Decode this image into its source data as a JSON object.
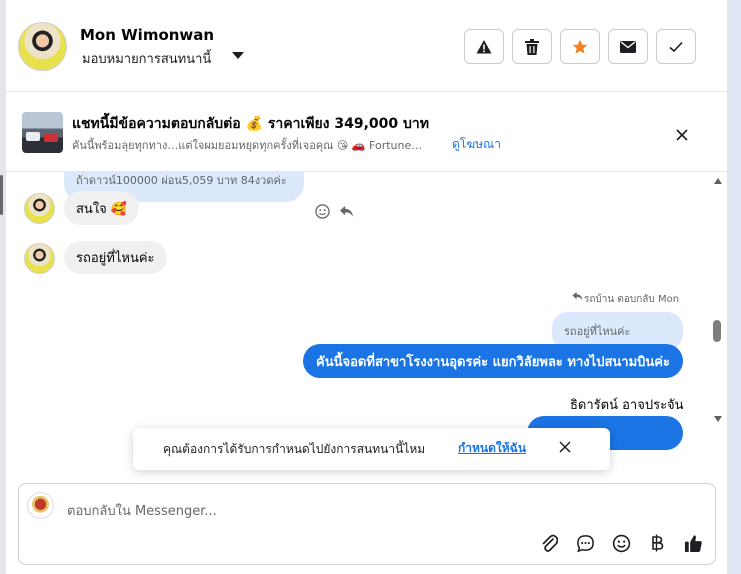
{
  "header": {
    "contact_name": "Mon Wimonwan",
    "assign_label": "มอบหมายการสนทนานี้",
    "actions": [
      "report-spam",
      "delete",
      "star",
      "mark-unread",
      "mark-done"
    ]
  },
  "ad": {
    "title": "แชทนี้มีข้อความตอบกลับต่อ 💰 ราคาเพียง 349,000 บาท",
    "subtitle": "คันนี้พร้อมลุยทุกทาง…แต่ใจผมยอมหยุดทุกครั้งที่เจอคุณ 😘 🚗 Fortune…",
    "link": "ดูโฆษณา"
  },
  "messages": {
    "cut_bubble": "ถ้าดาวน์100000 ผ่อน5,059 บาท 84งวดค่ะ",
    "incoming_1": "สนใจ 🥰",
    "incoming_2": "รถอยู่ที่ไหนค่ะ",
    "reply_note": "รถบ้าน ตอบกลับ Mon",
    "quoted_text": "รถอยู่ที่ไหนค่ะ",
    "outgoing_1": "คันนี้จอดที่สาขาโรงงานอุดรค่ะ แยกวิลัยพละ ทางไปสนามบินค่ะ",
    "sender_name": "ธิดารัตน์ อาจประจัน"
  },
  "toast": {
    "text": "คุณต้องการได้รับการกำหนดไปยังการสนทนานี้ไหม",
    "link": "กำหนดให้ฉัน"
  },
  "composer": {
    "placeholder": "ตอบกลับใน Messenger...",
    "tools": [
      "attach-icon",
      "saved-replies-icon",
      "emoji-icon",
      "baht-icon",
      "thumbs-up-icon"
    ]
  },
  "colors": {
    "accent": "#1b74e4",
    "star": "#f5821f",
    "incoming_bg": "#f0f0f0",
    "quoted_bg": "#dce8fb"
  }
}
